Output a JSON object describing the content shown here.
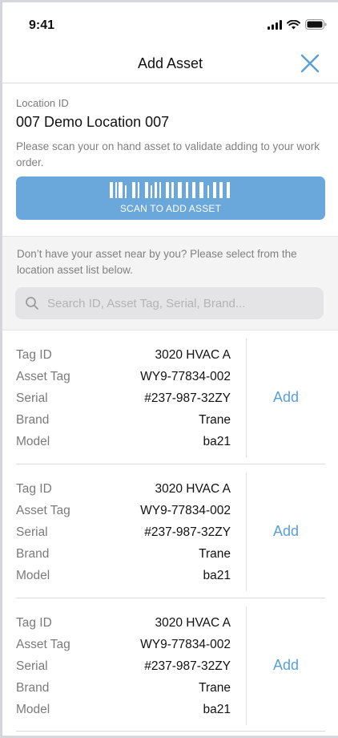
{
  "status_bar": {
    "time": "9:41"
  },
  "header": {
    "title": "Add Asset"
  },
  "scan_section": {
    "location_label": "Location ID",
    "location_value": "007 Demo Location 007",
    "description": "Please scan your on hand asset to validate adding to your work order.",
    "scan_button_label": "SCAN TO ADD ASSET"
  },
  "search_section": {
    "description": "Don’t have your asset near by you? Please select from the location asset list below.",
    "placeholder": "Search ID, Asset Tag, Serial, Brand..."
  },
  "assets": [
    {
      "fields": [
        {
          "label": "Tag ID",
          "value": "3020 HVAC A"
        },
        {
          "label": "Asset Tag",
          "value": "WY9-77834-002"
        },
        {
          "label": "Serial",
          "value": "#237-987-32ZY"
        },
        {
          "label": "Brand",
          "value": "Trane"
        },
        {
          "label": "Model",
          "value": "ba21"
        }
      ],
      "action_label": "Add"
    },
    {
      "fields": [
        {
          "label": "Tag ID",
          "value": "3020 HVAC A"
        },
        {
          "label": "Asset Tag",
          "value": "WY9-77834-002"
        },
        {
          "label": "Serial",
          "value": "#237-987-32ZY"
        },
        {
          "label": "Brand",
          "value": "Trane"
        },
        {
          "label": "Model",
          "value": "ba21"
        }
      ],
      "action_label": "Add"
    },
    {
      "fields": [
        {
          "label": "Tag ID",
          "value": "3020 HVAC A"
        },
        {
          "label": "Asset Tag",
          "value": "WY9-77834-002"
        },
        {
          "label": "Serial",
          "value": "#237-987-32ZY"
        },
        {
          "label": "Brand",
          "value": "Trane"
        },
        {
          "label": "Model",
          "value": "ba21"
        }
      ],
      "action_label": "Add"
    }
  ],
  "icons": {
    "close": "close-icon",
    "search": "search-icon",
    "barcode": "barcode-icon",
    "signal": "signal-icon",
    "wifi": "wifi-icon",
    "battery": "battery-icon"
  },
  "colors": {
    "accent": "#6aa7da",
    "link": "#5a9fd6",
    "label": "#7a7a7a",
    "background_alt": "#f4f4f5"
  }
}
